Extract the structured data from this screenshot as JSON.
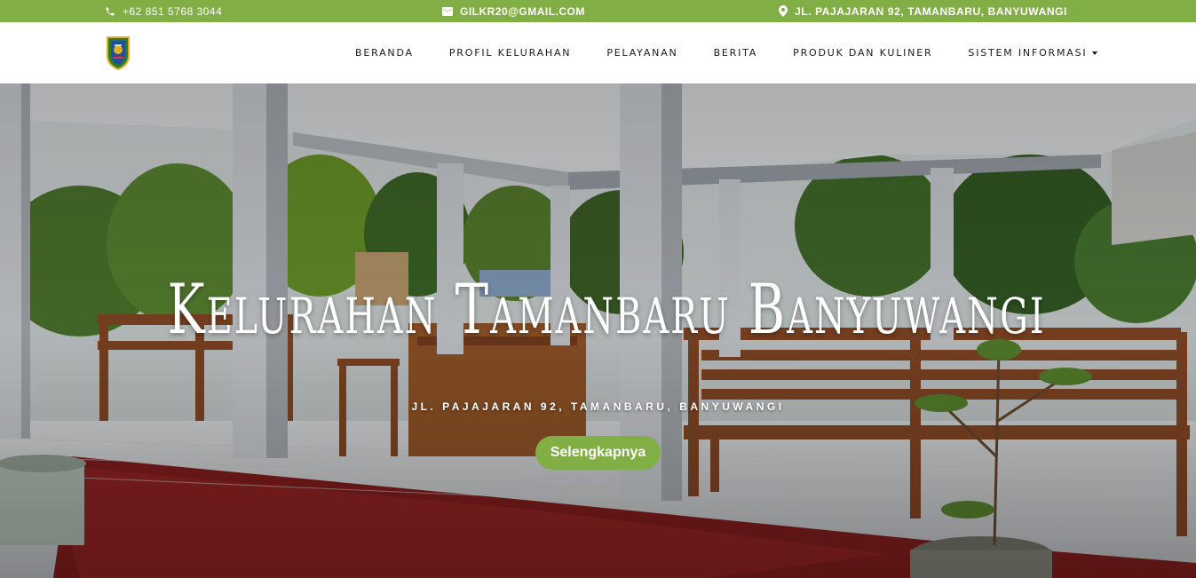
{
  "topbar": {
    "phone": "+62 851 5768 3044",
    "email": "GILKR20@GMAIL.COM",
    "address": "JL. PAJAJARAN 92, TAMANBARU, BANYUWANGI",
    "background": "#82ae46"
  },
  "nav": {
    "items": [
      {
        "label": "BERANDA"
      },
      {
        "label": "PROFIL KELURAHAN"
      },
      {
        "label": "PELAYANAN"
      },
      {
        "label": "BERITA"
      },
      {
        "label": "PRODUK DAN KULINER"
      },
      {
        "label": "SISTEM INFORMASI",
        "dropdown": true
      }
    ]
  },
  "hero": {
    "title": "Kelurahan Tamanbaru Banyuwangi",
    "subtitle": "JL. PAJAJARAN 92, TAMANBARU, BANYUWANGI",
    "button_label": "Selengkapnya",
    "accent": "#82ae46"
  },
  "icons": {
    "phone": "phone-icon",
    "email": "envelope-icon",
    "address": "map-pin-icon",
    "logo": "banyuwangi-emblem"
  }
}
